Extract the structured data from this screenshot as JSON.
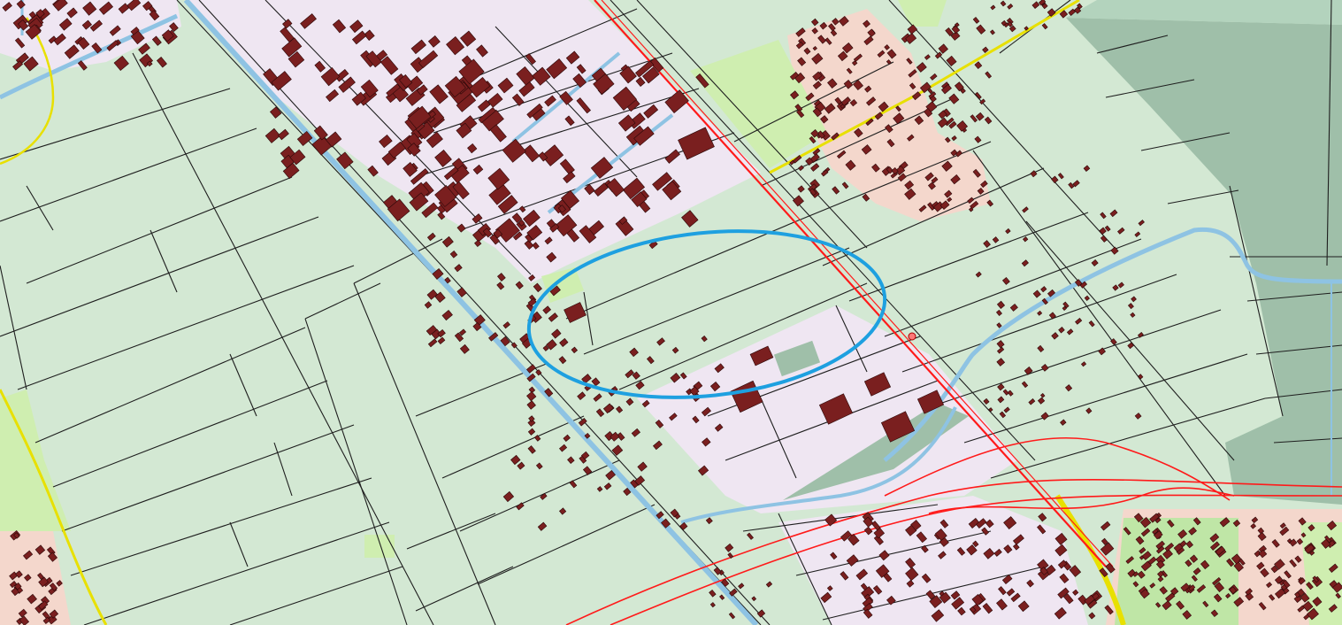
{
  "map": {
    "colors": {
      "agricultural": "#d3e8d3",
      "industrial": "#efe6f2",
      "residential": "#f4d7cc",
      "green_space": "#cfeeb0",
      "nature": "#9fbfa9",
      "water": "#8ec3e3",
      "building": "#7a1f1f",
      "parcel_line": "#1e1e1e",
      "railway": "#ff1a1a",
      "main_road": "#e8e000",
      "highlight": "#1ea0e0"
    },
    "highlight_marker": "ellipse-highlight"
  }
}
